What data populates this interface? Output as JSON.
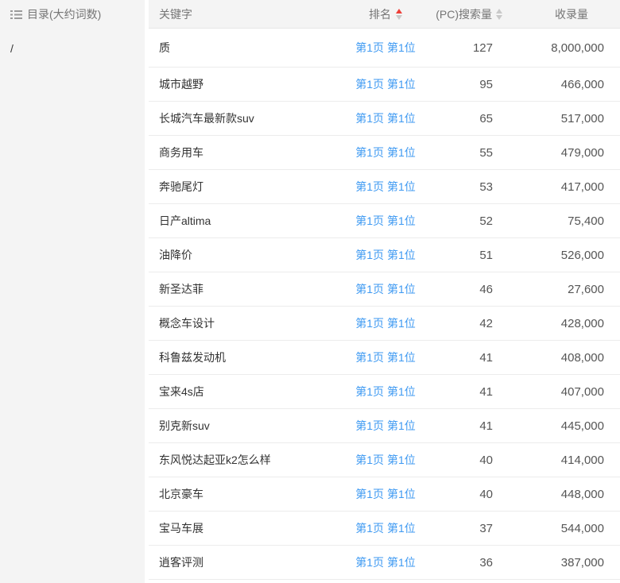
{
  "sidebar": {
    "title": "目录(大约词数)",
    "items": [
      {
        "label": "/"
      }
    ]
  },
  "table": {
    "header": {
      "keyword": "关键字",
      "rank": "排名",
      "pc_search": "(PC)搜索量",
      "index": "收录量"
    },
    "sort_state": {
      "rank": "asc-active",
      "pc_search": "inactive"
    },
    "rows": [
      {
        "keyword": "质",
        "rank_link": "第1页 第1位",
        "pc_search": "127",
        "index_volume": "8,000,000"
      },
      {
        "keyword": "城市越野",
        "rank_link": "第1页 第1位",
        "pc_search": "95",
        "index_volume": "466,000"
      },
      {
        "keyword": "长城汽车最新款suv",
        "rank_link": "第1页 第1位",
        "pc_search": "65",
        "index_volume": "517,000"
      },
      {
        "keyword": "商务用车",
        "rank_link": "第1页 第1位",
        "pc_search": "55",
        "index_volume": "479,000"
      },
      {
        "keyword": "奔驰尾灯",
        "rank_link": "第1页 第1位",
        "pc_search": "53",
        "index_volume": "417,000"
      },
      {
        "keyword": "日产altima",
        "rank_link": "第1页 第1位",
        "pc_search": "52",
        "index_volume": "75,400"
      },
      {
        "keyword": "油降价",
        "rank_link": "第1页 第1位",
        "pc_search": "51",
        "index_volume": "526,000"
      },
      {
        "keyword": "新圣达菲",
        "rank_link": "第1页 第1位",
        "pc_search": "46",
        "index_volume": "27,600"
      },
      {
        "keyword": "概念车设计",
        "rank_link": "第1页 第1位",
        "pc_search": "42",
        "index_volume": "428,000"
      },
      {
        "keyword": "科鲁兹发动机",
        "rank_link": "第1页 第1位",
        "pc_search": "41",
        "index_volume": "408,000"
      },
      {
        "keyword": "宝来4s店",
        "rank_link": "第1页 第1位",
        "pc_search": "41",
        "index_volume": "407,000"
      },
      {
        "keyword": "别克新suv",
        "rank_link": "第1页 第1位",
        "pc_search": "41",
        "index_volume": "445,000"
      },
      {
        "keyword": "东风悦达起亚k2怎么样",
        "rank_link": "第1页 第1位",
        "pc_search": "40",
        "index_volume": "414,000"
      },
      {
        "keyword": "北京豪车",
        "rank_link": "第1页 第1位",
        "pc_search": "40",
        "index_volume": "448,000"
      },
      {
        "keyword": "宝马车展",
        "rank_link": "第1页 第1位",
        "pc_search": "37",
        "index_volume": "544,000"
      },
      {
        "keyword": "逍客评测",
        "rank_link": "第1页 第1位",
        "pc_search": "36",
        "index_volume": "387,000"
      }
    ]
  },
  "colors": {
    "link_blue": "#3f9af2",
    "sort_active_red": "#ee3f38",
    "sort_inactive_gray": "#c9c9c9",
    "panel_gray": "#f4f4f4"
  },
  "icons": {
    "sidebar_icon": "list-icon"
  }
}
